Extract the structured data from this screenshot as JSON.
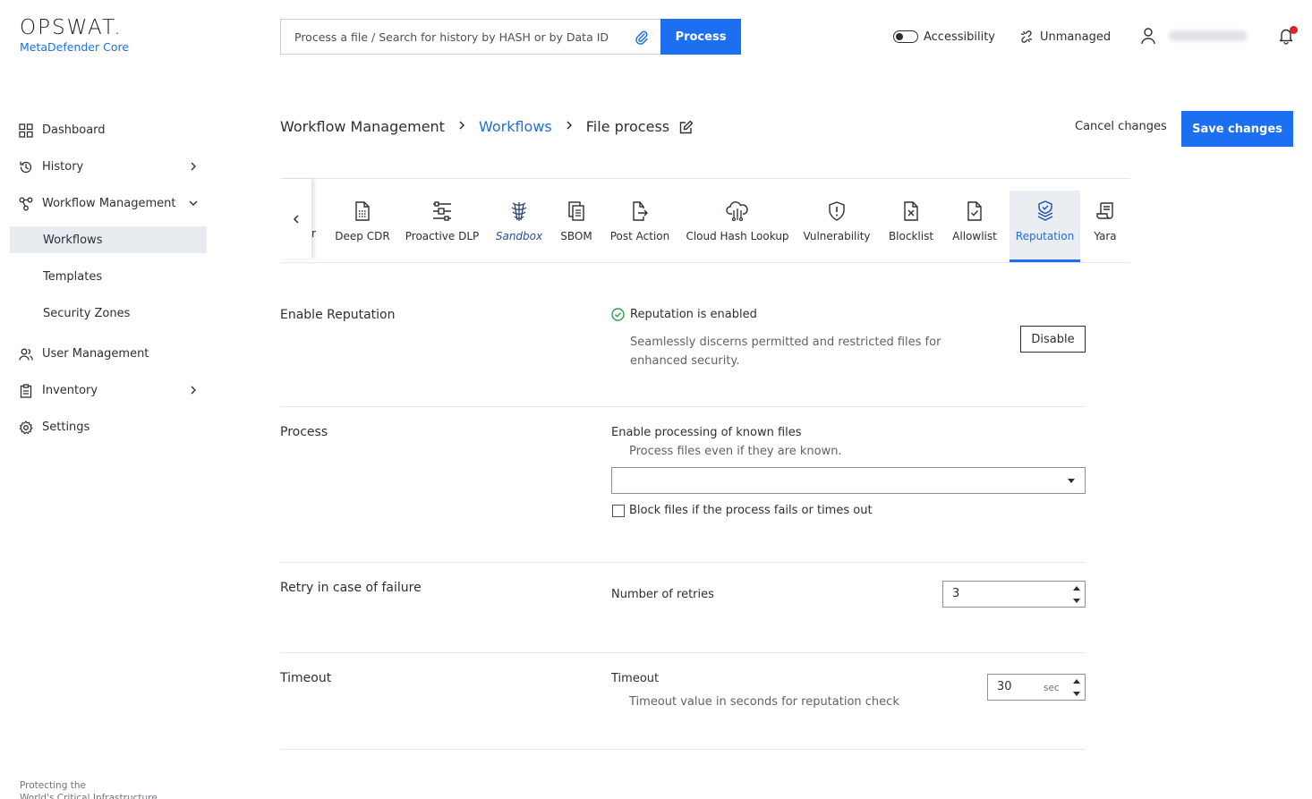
{
  "brand": {
    "name": "OPSWAT.",
    "product": "MetaDefender Core"
  },
  "search": {
    "placeholder": "Process a file / Search for history by HASH or by Data ID",
    "button": "Process"
  },
  "topbar": {
    "accessibility": "Accessibility",
    "unmanaged": "Unmanaged"
  },
  "sidebar": {
    "items": [
      {
        "label": "Dashboard"
      },
      {
        "label": "History"
      },
      {
        "label": "Workflow Management"
      },
      {
        "label": "User Management"
      },
      {
        "label": "Inventory"
      },
      {
        "label": "Settings"
      }
    ],
    "sub": [
      {
        "label": "Workflows"
      },
      {
        "label": "Templates"
      },
      {
        "label": "Security Zones"
      }
    ],
    "footer_line1": "Protecting the",
    "footer_line2": "World's Critical Infrastructure"
  },
  "breadcrumb": {
    "root": "Workflow Management",
    "link": "Workflows",
    "current": "File process"
  },
  "actions": {
    "cancel": "Cancel changes",
    "save": "Save changes"
  },
  "tabs": {
    "cut": "r",
    "items": [
      {
        "label": "Deep CDR",
        "icon": "deep-cdr-icon"
      },
      {
        "label": "Proactive DLP",
        "icon": "proactive-dlp-icon"
      },
      {
        "label": "Sandbox",
        "icon": "sandbox-icon"
      },
      {
        "label": "SBOM",
        "icon": "sbom-icon"
      },
      {
        "label": "Post Action",
        "icon": "post-action-icon"
      },
      {
        "label": "Cloud Hash Lookup",
        "icon": "cloud-hash-lookup-icon"
      },
      {
        "label": "Vulnerability",
        "icon": "vulnerability-icon"
      },
      {
        "label": "Blocklist",
        "icon": "blocklist-icon"
      },
      {
        "label": "Allowlist",
        "icon": "allowlist-icon"
      },
      {
        "label": "Reputation",
        "icon": "reputation-icon"
      },
      {
        "label": "Yara",
        "icon": "yara-icon"
      }
    ],
    "active": "Reputation"
  },
  "enable": {
    "title": "Enable Reputation",
    "status": "Reputation is enabled",
    "description": "Seamlessly discerns permitted and restricted files for enhanced security.",
    "button": "Disable"
  },
  "process": {
    "title": "Process",
    "label": "Enable processing of known files",
    "sublabel": "Process files even if they are known.",
    "select_value": "",
    "checkbox_label": "Block files if the process fails or times out",
    "checkbox_checked": false
  },
  "retry": {
    "title": "Retry in case of failure",
    "label": "Number of retries",
    "value": "3"
  },
  "timeout": {
    "title": "Timeout",
    "label": "Timeout",
    "sublabel": "Timeout value in seconds for reputation check",
    "value": "30",
    "unit": "sec"
  },
  "colors": {
    "accent": "#1d6ff2",
    "link": "#1d6fe0",
    "success": "#2e9e4f",
    "alert": "#e0202a"
  }
}
